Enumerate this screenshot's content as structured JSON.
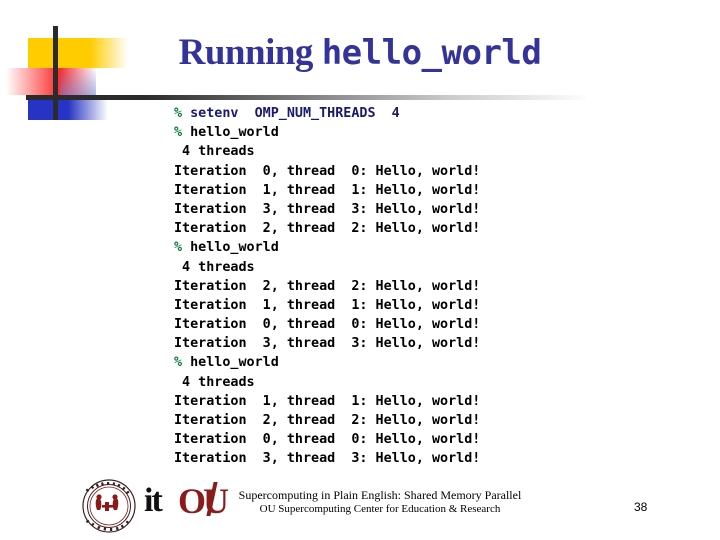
{
  "slide": {
    "title_plain": "Running ",
    "title_code": "hello_world",
    "title_color": "#333399"
  },
  "decor": {
    "yellow": "#ffcc00",
    "red": "#fb2b2b",
    "blue": "#2633c4",
    "bar": "#2b2b2b"
  },
  "terminal": {
    "prompt_color": "#0f8040",
    "command_color": "#191970",
    "output_color": "#000000",
    "lines": [
      {
        "prompt": "%",
        "text": " setenv  OMP_NUM_THREADS  4",
        "style": "cmd1"
      },
      {
        "prompt": "%",
        "text": " hello_world",
        "style": "out"
      },
      {
        "prompt": "",
        "text": " 4 threads",
        "style": "out"
      },
      {
        "prompt": "",
        "text": "Iteration  0, thread  0: Hello, world!",
        "style": "out"
      },
      {
        "prompt": "",
        "text": "Iteration  1, thread  1: Hello, world!",
        "style": "out"
      },
      {
        "prompt": "",
        "text": "Iteration  3, thread  3: Hello, world!",
        "style": "out"
      },
      {
        "prompt": "",
        "text": "Iteration  2, thread  2: Hello, world!",
        "style": "out"
      },
      {
        "prompt": "%",
        "text": " hello_world",
        "style": "out"
      },
      {
        "prompt": "",
        "text": " 4 threads",
        "style": "out"
      },
      {
        "prompt": "",
        "text": "Iteration  2, thread  2: Hello, world!",
        "style": "out"
      },
      {
        "prompt": "",
        "text": "Iteration  1, thread  1: Hello, world!",
        "style": "out"
      },
      {
        "prompt": "",
        "text": "Iteration  0, thread  0: Hello, world!",
        "style": "out"
      },
      {
        "prompt": "",
        "text": "Iteration  3, thread  3: Hello, world!",
        "style": "out"
      },
      {
        "prompt": "%",
        "text": " hello_world",
        "style": "out"
      },
      {
        "prompt": "",
        "text": " 4 threads",
        "style": "out"
      },
      {
        "prompt": "",
        "text": "Iteration  1, thread  1: Hello, world!",
        "style": "out"
      },
      {
        "prompt": "",
        "text": "Iteration  2, thread  2: Hello, world!",
        "style": "out"
      },
      {
        "prompt": "",
        "text": "Iteration  0, thread  0: Hello, world!",
        "style": "out"
      },
      {
        "prompt": "",
        "text": "Iteration  3, thread  3: Hello, world!",
        "style": "out"
      }
    ]
  },
  "footer": {
    "line1": "Supercomputing in Plain English: Shared Memory Parallel",
    "line2": "OU Supercomputing Center for Education & Research",
    "page_number": "38",
    "logo_it": "it",
    "logo_ou": "OU",
    "seal_color": "#8b1a1a"
  }
}
